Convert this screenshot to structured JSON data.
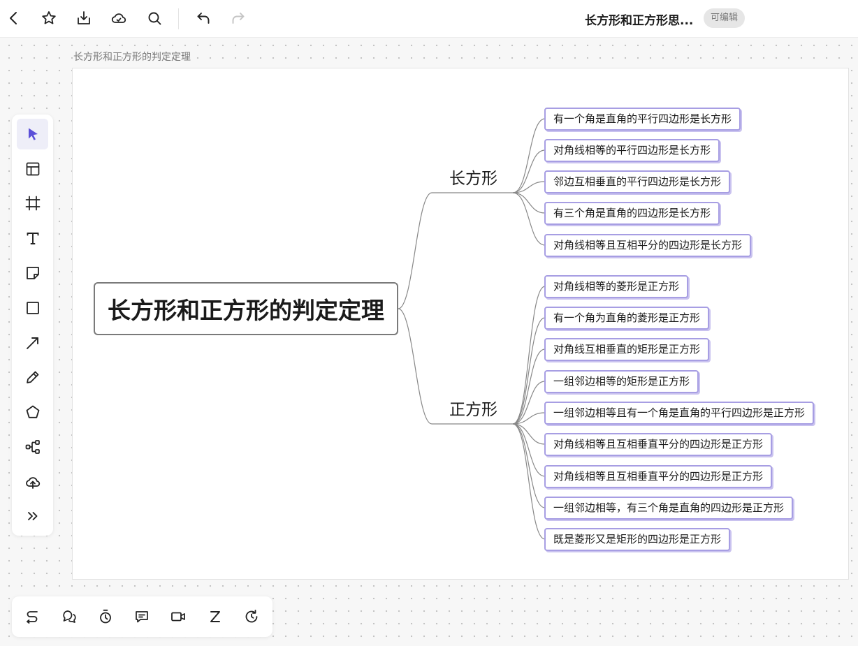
{
  "topbar": {
    "title": "长方形和正方形思...",
    "badge": "可编辑",
    "icons": [
      "back-icon",
      "star-icon",
      "download-icon",
      "cloud-icon",
      "search-icon",
      "undo-icon",
      "redo-icon"
    ]
  },
  "frame": {
    "label": "长方形和正方形的判定定理"
  },
  "left_toolbar": {
    "items": [
      "select-tool",
      "template-tool",
      "frame-tool",
      "text-tool",
      "sticky-note-tool",
      "shape-tool",
      "connector-tool",
      "pen-tool",
      "polygon-tool",
      "mind-map-tool",
      "upload-tool",
      "more-tools"
    ]
  },
  "bottom_toolbar": {
    "items": [
      "flow-tool",
      "chat-tool",
      "timer-tool",
      "comment-tool",
      "video-tool",
      "z-tool",
      "history-tool"
    ]
  },
  "mindmap": {
    "root": "长方形和正方形的判定定理",
    "branches": [
      {
        "label": "长方形",
        "children": [
          "有一个角是直角的平行四边形是长方形",
          "对角线相等的平行四边形是长方形",
          "邻边互相垂直的平行四边形是长方形",
          "有三个角是直角的四边形是长方形",
          "对角线相等且互相平分的四边形是长方形"
        ]
      },
      {
        "label": "正方形",
        "children": [
          "对角线相等的菱形是正方形",
          "有一个角为直角的菱形是正方形",
          "对角线互相垂直的矩形是正方形",
          "一组邻边相等的矩形是正方形",
          "一组邻边相等且有一个角是直角的平行四边形是正方形",
          "对角线相等且互相垂直平分的四边形是正方形",
          "对角线相等且互相垂直平分的四边形是正方形",
          "一组邻边相等，有三个角是直角的四边形是正方形",
          "既是菱形又是矩形的四边形是正方形"
        ]
      }
    ]
  },
  "colors": {
    "node_border": "#a79ee3",
    "accent": "#5b4fd8",
    "root_border": "#7a7a7a"
  }
}
